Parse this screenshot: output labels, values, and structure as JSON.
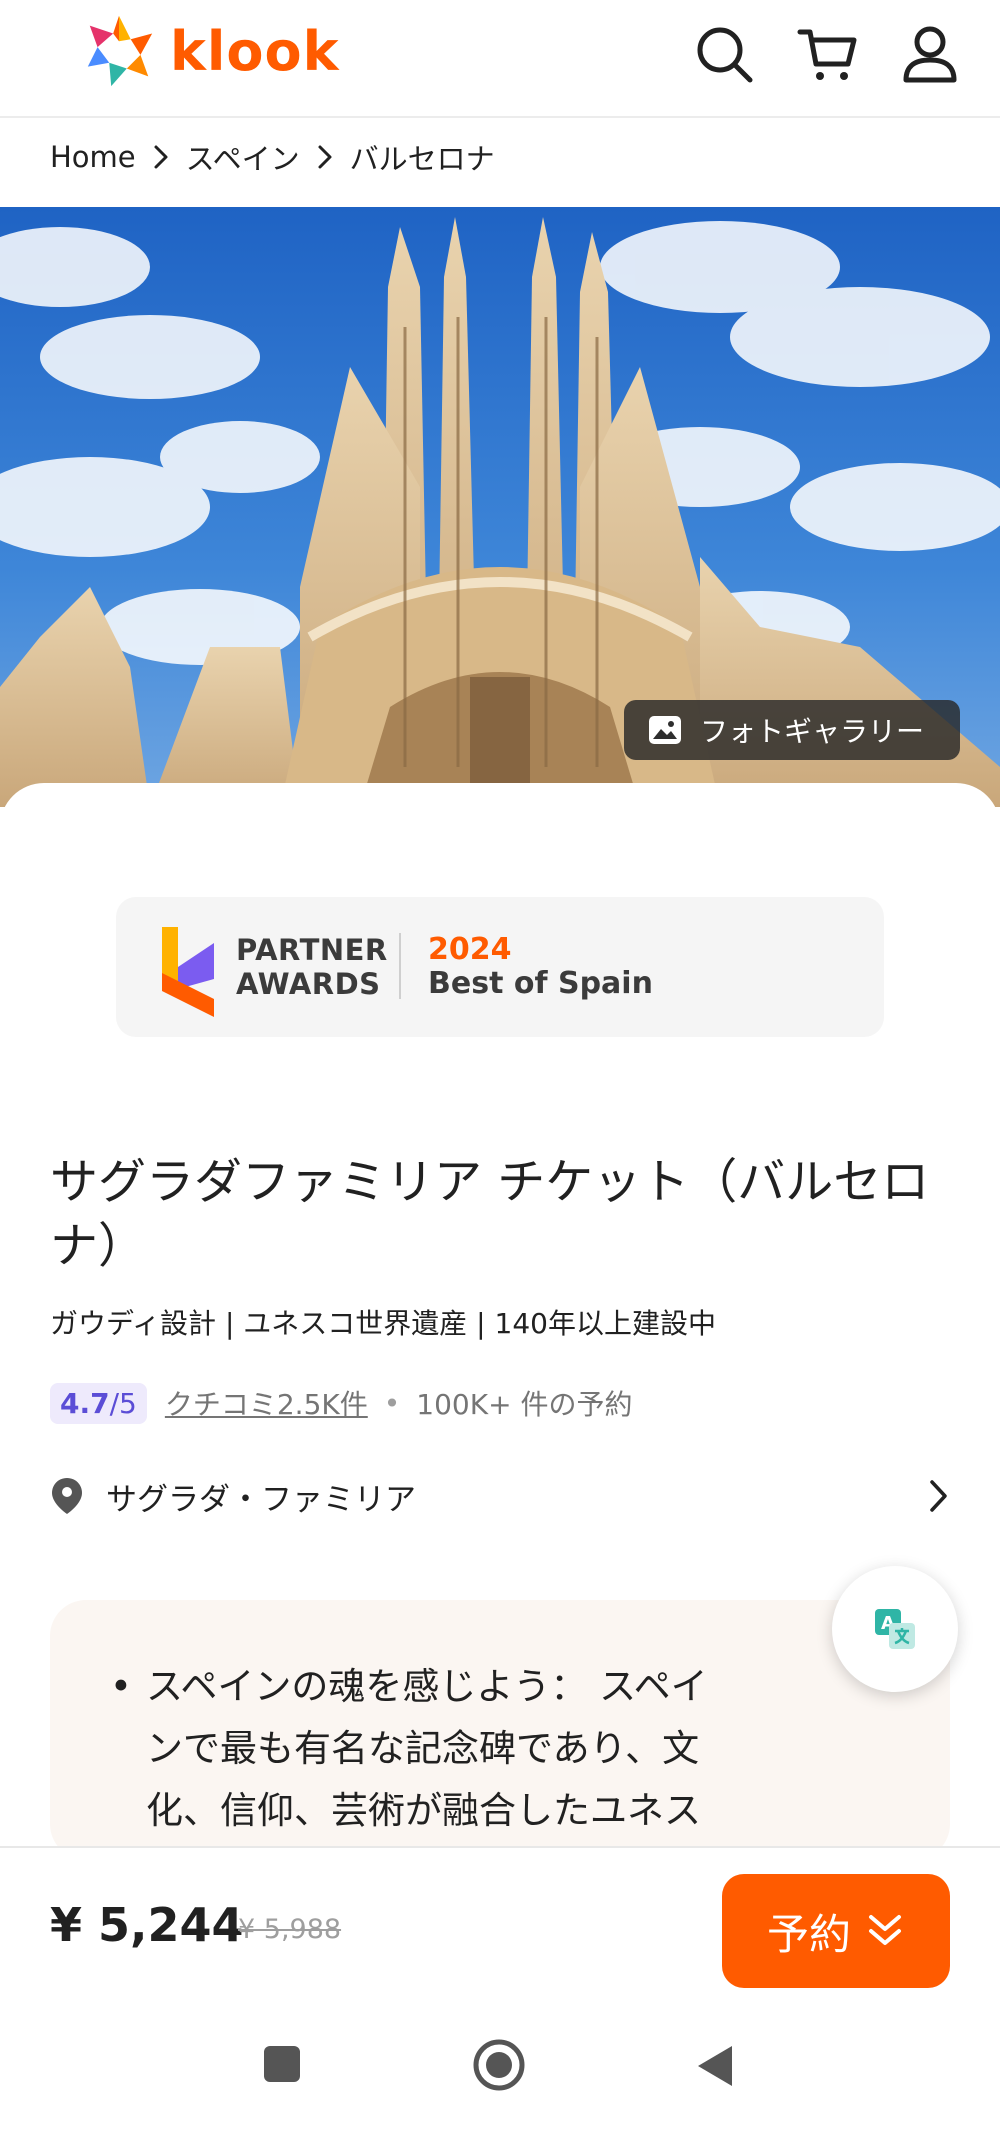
{
  "header": {
    "logo_text": "klook",
    "icons": [
      "search-icon",
      "cart-icon",
      "user-icon"
    ]
  },
  "breadcrumb": {
    "items": [
      "Home",
      "スペイン",
      "バルセロナ"
    ]
  },
  "hero": {
    "gallery_label": "フォトギャラリー"
  },
  "award": {
    "line1": "PARTNER",
    "line2": "AWARDS",
    "year": "2024",
    "title": "Best of Spain"
  },
  "product": {
    "title": "サグラダファミリア チケット（バルセロナ）",
    "subtitle": "ガウディ設計 | ユネスコ世界遺産 | 140年以上建設中",
    "rating": "4.7",
    "rating_max": "/5",
    "reviews": "クチコミ2.5K件",
    "separator": "•",
    "bookings": "100K+ 件の予約",
    "location": "サグラダ・ファミリア"
  },
  "highlight": {
    "text": "スペインの魂を感じよう： スペインで最も有名な記念碑であり、文化、信仰、芸術が融合したユネス"
  },
  "bottom": {
    "price": "¥ 5,244",
    "old_price": "¥ 5,988",
    "book_label": "予約"
  },
  "colors": {
    "brand": "#ff5b00",
    "rating": "#5b4dd6",
    "highlight_bg": "#fbf6f2"
  }
}
